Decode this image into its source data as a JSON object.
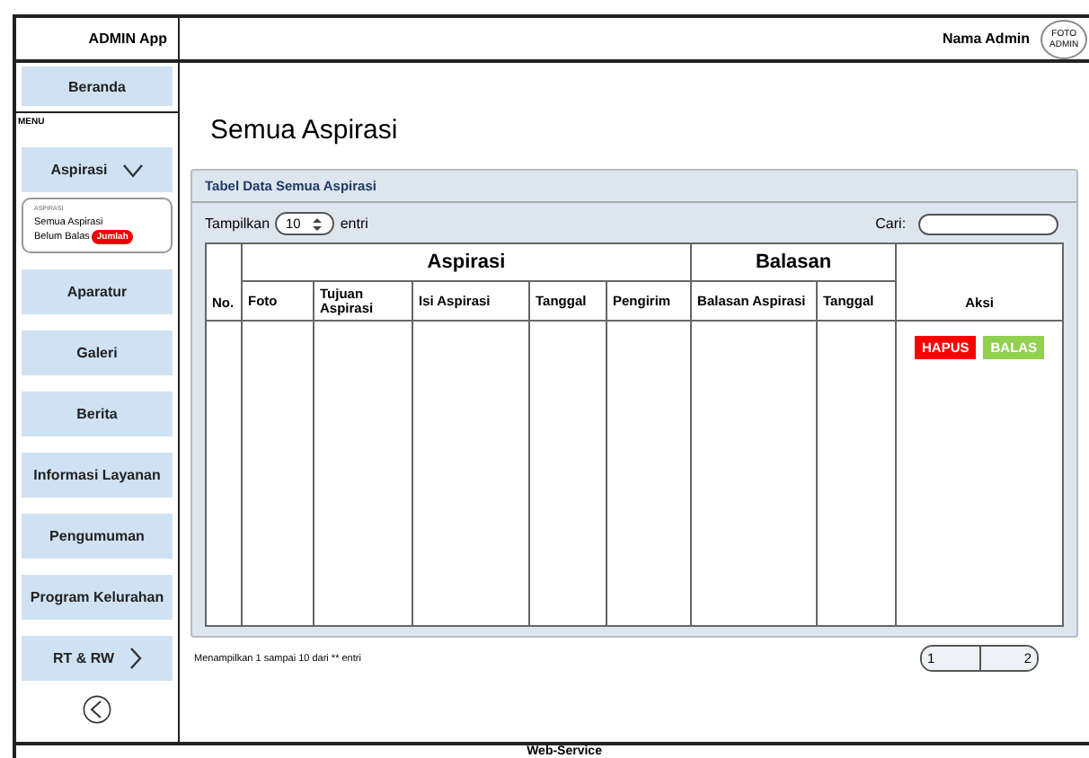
{
  "header": {
    "app_title": "ADMIN App",
    "admin_name": "Nama Admin",
    "avatar_text": "FOTO ADMIN"
  },
  "sidebar": {
    "top_items": [
      {
        "label": "Beranda"
      }
    ],
    "menu_label": "MENU",
    "items": [
      {
        "label": "Aspirasi",
        "kind": "expandable",
        "expanded": true,
        "submenu": {
          "title": "ASPIRASI",
          "items": [
            {
              "label": "Semua Aspirasi"
            },
            {
              "label": "Belum Balas",
              "badge": "Jumlah"
            }
          ]
        }
      },
      {
        "label": "Aparatur",
        "kind": "plain"
      },
      {
        "label": "Galeri",
        "kind": "plain"
      },
      {
        "label": "Berita",
        "kind": "plain"
      },
      {
        "label": "Informasi Layanan",
        "kind": "plain"
      },
      {
        "label": "Pengumuman",
        "kind": "plain"
      },
      {
        "label": "Program Kelurahan",
        "kind": "plain"
      },
      {
        "label": "RT & RW",
        "kind": "expandable",
        "expanded": false
      }
    ]
  },
  "page_title": "Semua Aspirasi",
  "panel": {
    "title": "Tabel Data Semua Aspirasi",
    "show_label": "Tampilkan",
    "page_size": "10",
    "show_suffix": "entri",
    "search_label": "Cari:",
    "columns": [
      {
        "label": "No."
      },
      {
        "label": "Aspirasi",
        "children": [
          {
            "label": "Foto"
          },
          {
            "label": "Tujuan Aspirasi"
          },
          {
            "label": "Isi Aspirasi"
          },
          {
            "label": "Tanggal"
          },
          {
            "label": "Pengirim"
          }
        ]
      },
      {
        "label": "Balasan",
        "children": [
          {
            "label": "Balasan Aspirasi"
          },
          {
            "label": "Tanggal"
          }
        ]
      },
      {
        "label": "Aksi"
      }
    ],
    "actions": [
      {
        "label": "HAPUS",
        "kind": "delete"
      },
      {
        "label": "BALAS",
        "kind": "reply"
      }
    ]
  },
  "summary": "Menampilkan 1 sampai 10 dari ** entri",
  "pages": [
    {
      "label": "1"
    },
    {
      "label": "2"
    }
  ],
  "footer": "Web-Service"
}
